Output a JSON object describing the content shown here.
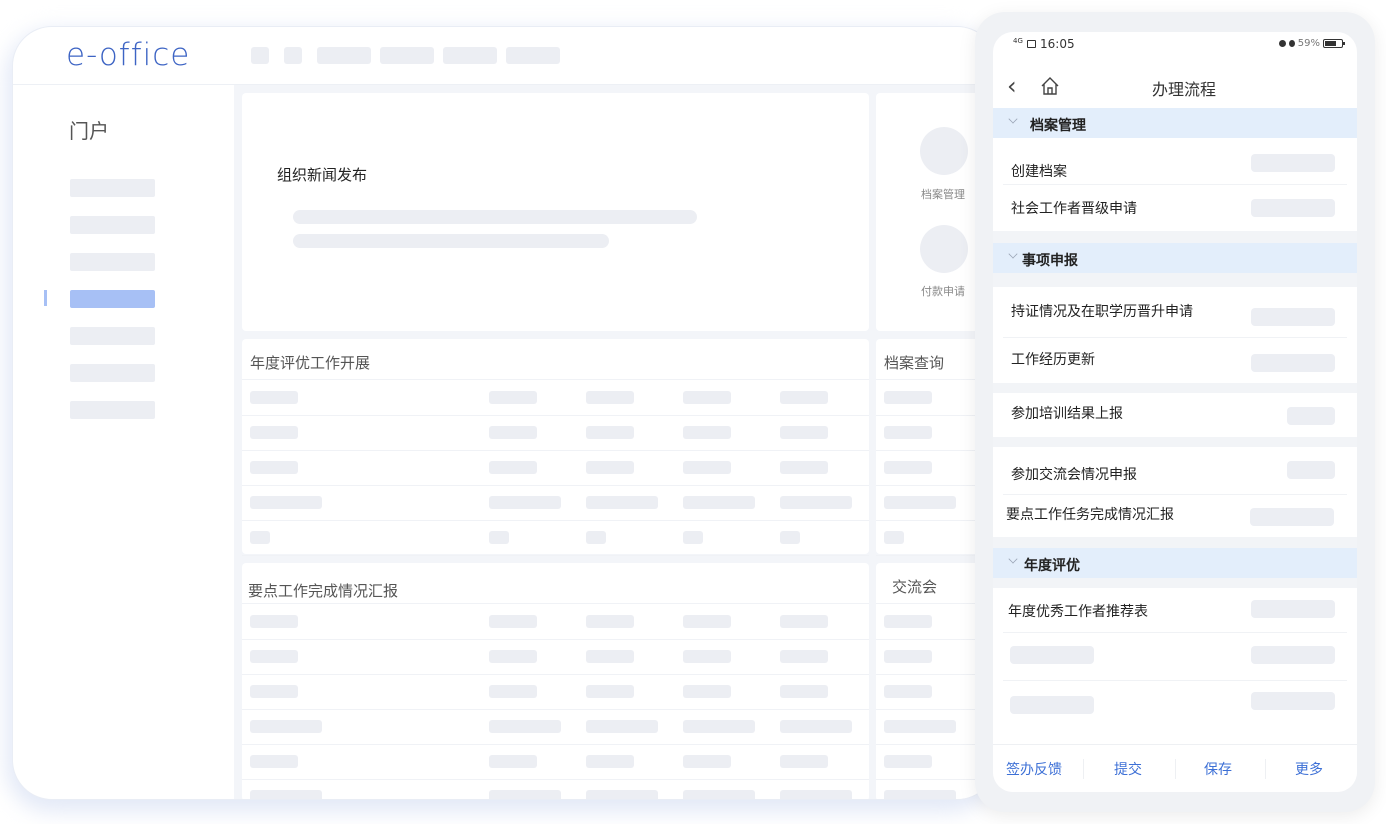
{
  "desktop": {
    "logo": "e-office",
    "sidebar": {
      "title": "门户"
    },
    "news_card": {
      "title": "组织新闻发布"
    },
    "shortcuts": [
      {
        "label": "档案管理"
      },
      {
        "label": "付款申请"
      }
    ],
    "panels": {
      "annual_review": {
        "title": "年度评优工作开展"
      },
      "archive_query": {
        "title": "档案查询"
      },
      "key_work_report": {
        "title": "要点工作完成情况汇报"
      },
      "exchange": {
        "title": "交流会"
      }
    }
  },
  "phone": {
    "status": {
      "network": "4G",
      "time": "16:05",
      "battery": "59%"
    },
    "nav": {
      "title": "办理流程"
    },
    "sections": [
      {
        "title": "档案管理",
        "items": [
          "创建档案",
          "社会工作者晋级申请"
        ]
      },
      {
        "title": "事项申报",
        "items": [
          "持证情况及在职学历晋升申请",
          "工作经历更新",
          "参加培训结果上报",
          "参加交流会情况申报",
          "要点工作任务完成情况汇报"
        ]
      },
      {
        "title": "年度评优",
        "items": [
          "年度优秀工作者推荐表"
        ]
      }
    ],
    "bottom_bar": {
      "feedback": "签办反馈",
      "submit": "提交",
      "save": "保存",
      "more": "更多"
    }
  },
  "colors": {
    "accent": "#3d70d6",
    "logo": "#3d64c4",
    "section_bg": "#e3eefb",
    "active": "#a7c0f5"
  }
}
